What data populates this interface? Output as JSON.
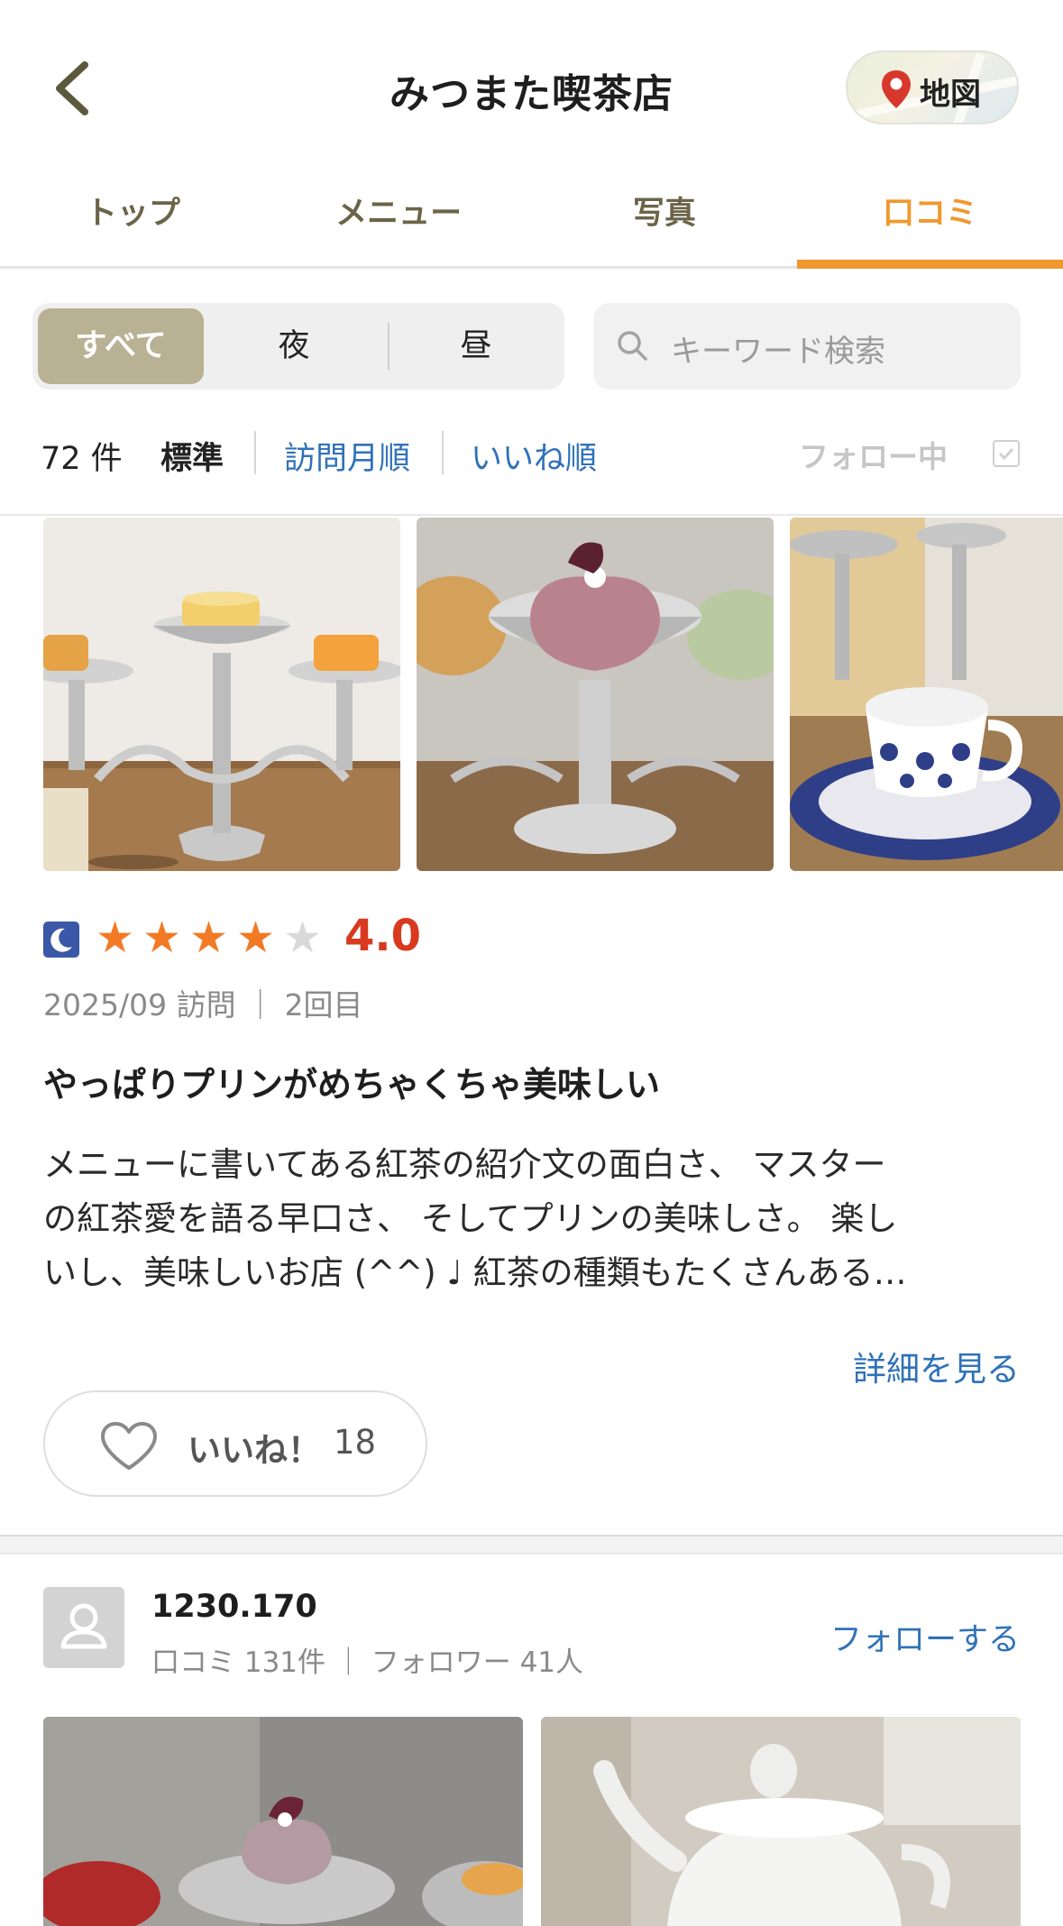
{
  "header": {
    "title": "みつまた喫茶店",
    "map_label": "地図",
    "accent_color": "#f0982f"
  },
  "tabs": [
    {
      "label": "トップ",
      "active": false
    },
    {
      "label": "メニュー",
      "active": false
    },
    {
      "label": "写真",
      "active": false
    },
    {
      "label": "口コミ",
      "active": true
    }
  ],
  "filter": {
    "segments": [
      "すべて",
      "夜",
      "昼"
    ],
    "selected": "すべて",
    "search_placeholder": "キーワード検索"
  },
  "sort": {
    "count": "72 件",
    "options": [
      "標準",
      "訪問月順",
      "いいね順"
    ],
    "selected": "標準",
    "follow_filter_label": "フォロー中",
    "follow_filter_checked": false
  },
  "review": {
    "time_icon": "moon-icon",
    "rating_stars": 4,
    "rating_max": 5,
    "score": "4.0",
    "visit": "2025/09 訪問 ｜ 2回目",
    "title": "やっぱりプリンがめちゃくちゃ美味しい",
    "body_lines": [
      "メニューに書いてある紅茶の紹介文の面白さ、 マスター",
      "の紅茶愛を語る早口さ、 そしてプリンの美味しさ。 楽し",
      "いし、美味しいお店 (^^) ♩ 紅茶の種類もたくさんある…"
    ],
    "details_link": "詳細を見る",
    "like_label": "いいね！",
    "like_count": "18"
  },
  "next_review": {
    "reviewer_name": "1230.170",
    "reviewer_meta": "口コミ 131件 ｜ フォロワー 41人",
    "follow_label": "フォローする"
  }
}
